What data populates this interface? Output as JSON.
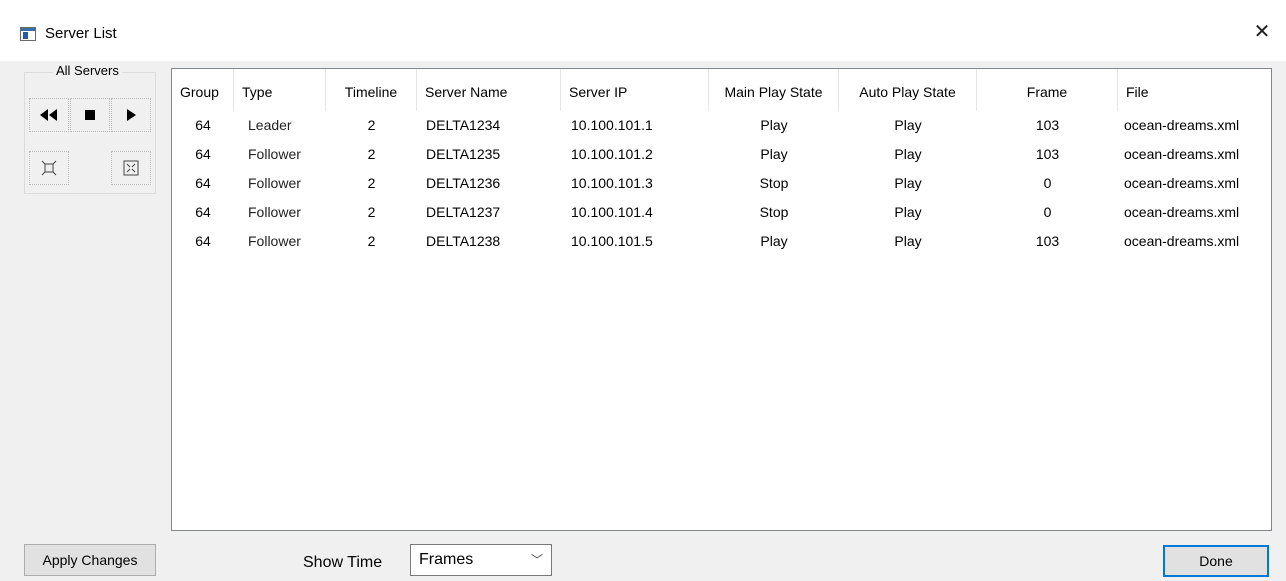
{
  "window": {
    "title": "Server List"
  },
  "group_box": {
    "label": "All Servers"
  },
  "toolbar": {
    "rewind_icon": "rewind-icon",
    "stop_icon": "stop-icon",
    "play_icon": "play-icon",
    "expand_icon": "expand-icon",
    "collapse_icon": "collapse-icon"
  },
  "table": {
    "columns": [
      "Group",
      "Type",
      "Timeline",
      "Server Name",
      "Server IP",
      "Main Play State",
      "Auto Play State",
      "Frame",
      "File"
    ],
    "rows": [
      [
        "64",
        "Leader",
        "2",
        "DELTA1234",
        "10.100.101.1",
        "Play",
        "Play",
        "103",
        "ocean-dreams.xml"
      ],
      [
        "64",
        "Follower",
        "2",
        "DELTA1235",
        "10.100.101.2",
        "Play",
        "Play",
        "103",
        "ocean-dreams.xml"
      ],
      [
        "64",
        "Follower",
        "2",
        "DELTA1236",
        "10.100.101.3",
        "Stop",
        "Play",
        "0",
        "ocean-dreams.xml"
      ],
      [
        "64",
        "Follower",
        "2",
        "DELTA1237",
        "10.100.101.4",
        "Stop",
        "Play",
        "0",
        "ocean-dreams.xml"
      ],
      [
        "64",
        "Follower",
        "2",
        "DELTA1238",
        "10.100.101.5",
        "Play",
        "Play",
        "103",
        "ocean-dreams.xml"
      ]
    ]
  },
  "footer": {
    "apply_label": "Apply Changes",
    "show_time_label": "Show Time",
    "show_time_value": "Frames",
    "done_label": "Done"
  },
  "colors": {
    "accent": "#0078d7",
    "window_bg": "#f0f0f0"
  }
}
